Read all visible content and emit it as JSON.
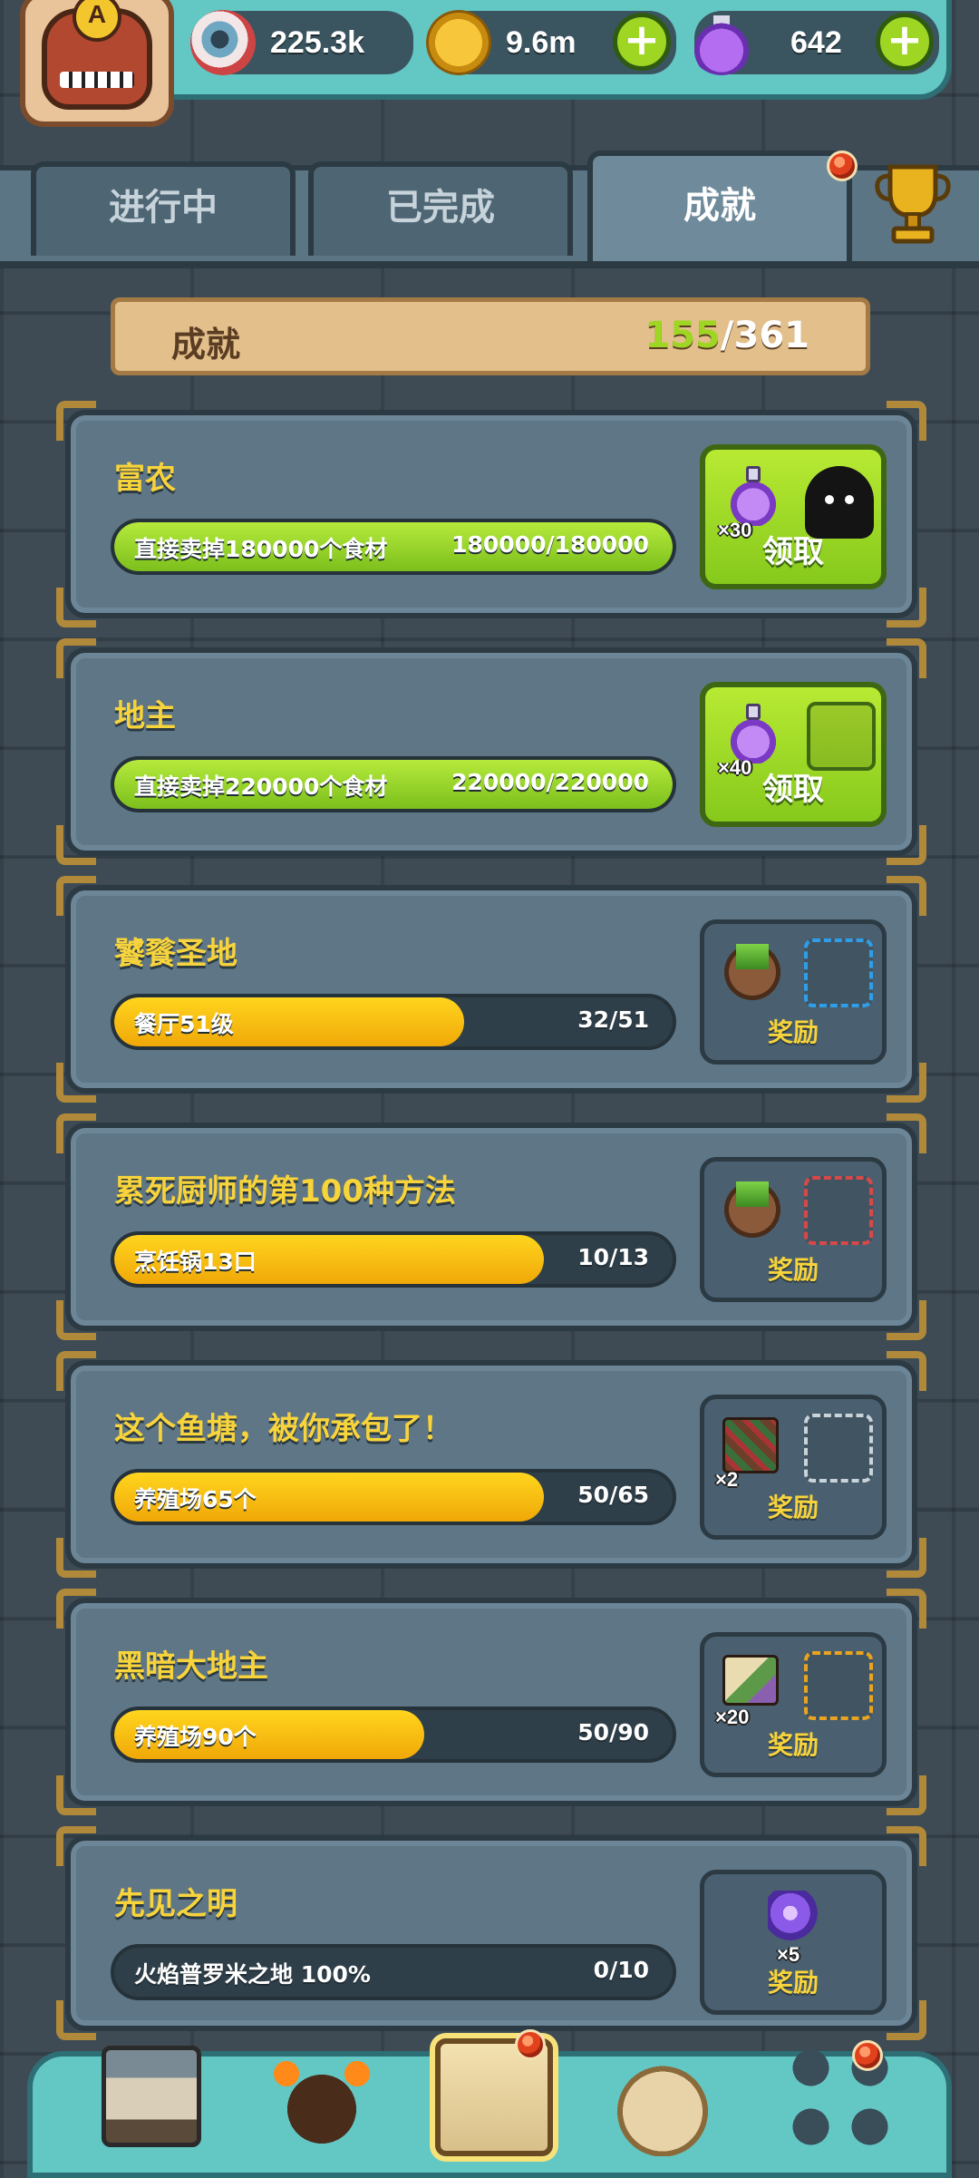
{
  "resources": [
    {
      "icon": "eyeball-icon",
      "value": "225.3k"
    },
    {
      "icon": "coin-icon",
      "value": "9.6m"
    },
    {
      "icon": "potion-icon",
      "value": "642"
    }
  ],
  "avatar": {
    "rank": "A"
  },
  "tabs": [
    "进行中",
    "已完成",
    "成就"
  ],
  "active_tab": 2,
  "summary": {
    "label": "成就",
    "done": "155",
    "total": "/361"
  },
  "achievements": [
    {
      "title": "富农",
      "task": "直接卖掉180000个食材",
      "progress": "180000/180000",
      "fraction": 1.0,
      "state": "claim",
      "reward_label": "领取",
      "reward_qty": "×30"
    },
    {
      "title": "地主",
      "task": "直接卖掉220000个食材",
      "progress": "220000/220000",
      "fraction": 1.0,
      "state": "claim",
      "reward_label": "领取",
      "reward_qty": "×40"
    },
    {
      "title": "饕餮圣地",
      "task": "餐厅51级",
      "progress": "32/51",
      "fraction": 0.627,
      "state": "locked",
      "reward_label": "奖励",
      "reward_qty": ""
    },
    {
      "title": "累死厨师的第100种方法",
      "task": "烹饪锅13口",
      "progress": "10/13",
      "fraction": 0.769,
      "state": "locked",
      "reward_label": "奖励",
      "reward_qty": ""
    },
    {
      "title": "这个鱼塘，被你承包了！",
      "task": "养殖场65个",
      "progress": "50/65",
      "fraction": 0.769,
      "state": "locked",
      "reward_label": "奖励",
      "reward_qty": "×2"
    },
    {
      "title": "黑暗大地主",
      "task": "养殖场90个",
      "progress": "50/90",
      "fraction": 0.556,
      "state": "locked",
      "reward_label": "奖励",
      "reward_qty": "×20"
    },
    {
      "title": "先见之明",
      "task": "火焰普罗米之地 100%",
      "progress": "0/10",
      "fraction": 0.0,
      "state": "locked",
      "reward_label": "奖励",
      "reward_qty": "×5"
    }
  ],
  "colors": {
    "progress_green": "#9ed623",
    "progress_yellow": "#ffcc12",
    "title_yellow": "#f7d33c"
  }
}
